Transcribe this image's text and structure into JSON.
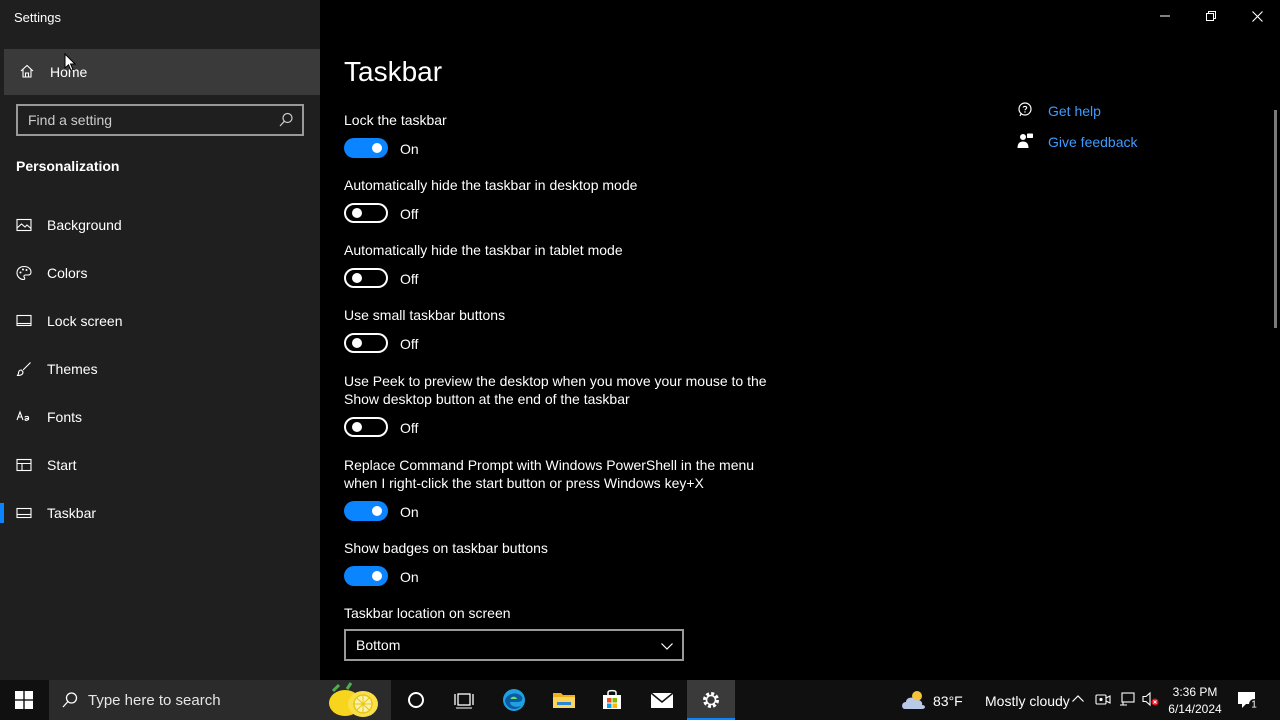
{
  "window": {
    "title": "Settings"
  },
  "sidebar": {
    "home_label": "Home",
    "search_placeholder": "Find a setting",
    "section_title": "Personalization",
    "items": [
      {
        "label": "Background",
        "icon": "image-icon"
      },
      {
        "label": "Colors",
        "icon": "palette-icon"
      },
      {
        "label": "Lock screen",
        "icon": "monitor-icon"
      },
      {
        "label": "Themes",
        "icon": "brush-icon"
      },
      {
        "label": "Fonts",
        "icon": "fonts-icon"
      },
      {
        "label": "Start",
        "icon": "start-layout-icon"
      },
      {
        "label": "Taskbar",
        "icon": "taskbar-icon",
        "active": true
      }
    ]
  },
  "main": {
    "title": "Taskbar",
    "settings": [
      {
        "label": "Lock the taskbar",
        "state": "On"
      },
      {
        "label": "Automatically hide the taskbar in desktop mode",
        "state": "Off"
      },
      {
        "label": "Automatically hide the taskbar in tablet mode",
        "state": "Off"
      },
      {
        "label": "Use small taskbar buttons",
        "state": "Off"
      },
      {
        "label": "Use Peek to preview the desktop when you move your mouse to the Show desktop button at the end of the taskbar",
        "state": "Off"
      },
      {
        "label": "Replace Command Prompt with Windows PowerShell in the menu when I right-click the start button or press Windows key+X",
        "state": "On"
      },
      {
        "label": "Show badges on taskbar buttons",
        "state": "On"
      }
    ],
    "location_label": "Taskbar location on screen",
    "location_value": "Bottom",
    "help": {
      "get_help": "Get help",
      "give_feedback": "Give feedback"
    }
  },
  "taskbar": {
    "search_text": "Type here to search",
    "weather_temp": "83°F",
    "weather_condition": "Mostly cloudy",
    "time": "3:36 PM",
    "date": "6/14/2024",
    "notification_count": "1"
  },
  "colors": {
    "accent": "#0a84ff",
    "link": "#3d9bff",
    "sidebar_bg": "#1f1f1f"
  }
}
